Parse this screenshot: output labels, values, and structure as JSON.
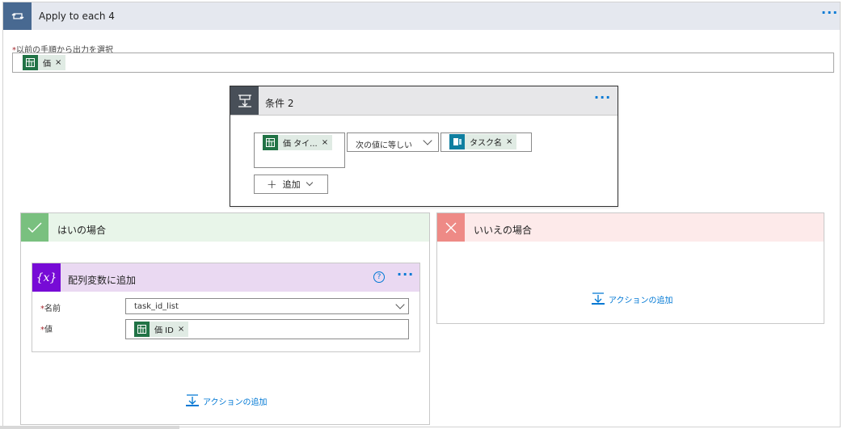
{
  "loop": {
    "title": "Apply to each 4",
    "more_icon": "more-dots-icon",
    "select_label_required": "*",
    "select_label": "以前の手順から出力を選択",
    "token": {
      "label": "価",
      "icon": "excel-table-icon"
    }
  },
  "condition": {
    "title": "条件 2",
    "left_token": {
      "label": "価 タイ...",
      "icon": "excel-table-icon"
    },
    "operator": "次の値に等しい",
    "right_token": {
      "label": "タスク名",
      "icon": "planner-icon"
    },
    "add_button": "追加",
    "remove_glyph": "×"
  },
  "yes_branch": {
    "title": "はいの場合",
    "action": {
      "title": "配列変数に追加",
      "icon_text": "{x}",
      "name_label": "名前",
      "name_value": "task_id_list",
      "value_label": "値",
      "value_token": {
        "label": "価 ID",
        "icon": "excel-table-icon"
      }
    },
    "add_action": "アクションの追加"
  },
  "no_branch": {
    "title": "いいえの場合",
    "add_action": "アクションの追加"
  },
  "colors": {
    "loop_header": "#e5e8ef",
    "loop_icon": "#486991",
    "condition_icon": "#484f58",
    "yes_header": "#e8f5e9",
    "yes_icon": "#79c07f",
    "no_header": "#fdeaea",
    "no_icon": "#ee8a86",
    "variable_header": "#ead9f2",
    "variable_icon": "#770bd6",
    "excel": "#217346",
    "link": "#0078d4"
  }
}
